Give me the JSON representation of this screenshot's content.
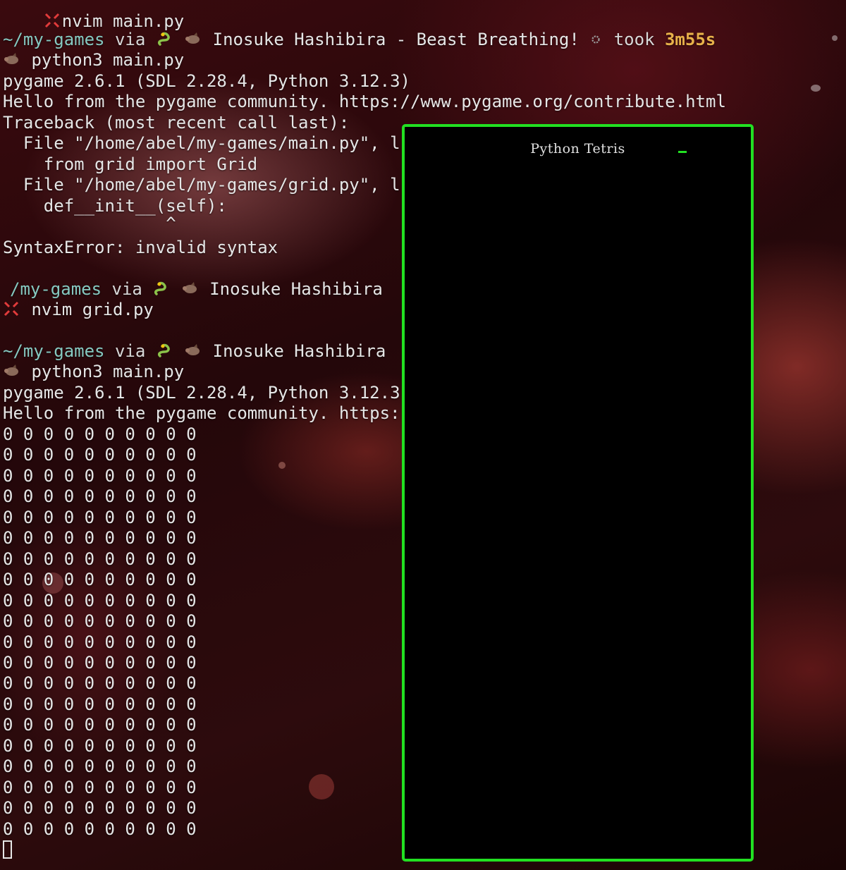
{
  "terminal": {
    "line0": "nvim main.py",
    "prompt1": {
      "path": "~/my-games",
      "via": " via ",
      "title": " Inosuke Hashibira - Beast Breathing! ",
      "took": " took ",
      "duration": "3m55s"
    },
    "cmd1": " python3 main.py",
    "out1": [
      "pygame 2.6.1 (SDL 2.28.4, Python 3.12.3)",
      "Hello from the pygame community. https://www.pygame.org/contribute.html",
      "Traceback (most recent call last):",
      "  File \"/home/abel/my-games/main.py\", l",
      "    from grid import Grid",
      "  File \"/home/abel/my-games/grid.py\", l",
      "    def__init__(self):",
      "                ^",
      "SyntaxError: invalid syntax"
    ],
    "prompt2": {
      "path": "/my-games",
      "via": " via ",
      "title": " Inosuke Hashibira"
    },
    "cmd2": " nvim grid.py",
    "prompt3": {
      "path": "~/my-games",
      "via": " via ",
      "title": " Inosuke Hashibira"
    },
    "cmd3": " python3 main.py",
    "out3": [
      "pygame 2.6.1 (SDL 2.28.4, Python 3.12.3",
      "Hello from the pygame community. https:"
    ],
    "grid_rows": [
      "0 0 0 0 0 0 0 0 0 0",
      "0 0 0 0 0 0 0 0 0 0",
      "0 0 0 0 0 0 0 0 0 0",
      "0 0 0 0 0 0 0 0 0 0",
      "0 0 0 0 0 0 0 0 0 0",
      "0 0 0 0 0 0 0 0 0 0",
      "0 0 0 0 0 0 0 0 0 0",
      "0 0 0 0 0 0 0 0 0 0",
      "0 0 0 0 0 0 0 0 0 0",
      "0 0 0 0 0 0 0 0 0 0",
      "0 0 0 0 0 0 0 0 0 0",
      "0 0 0 0 0 0 0 0 0 0",
      "0 0 0 0 0 0 0 0 0 0",
      "0 0 0 0 0 0 0 0 0 0",
      "0 0 0 0 0 0 0 0 0 0",
      "0 0 0 0 0 0 0 0 0 0",
      "0 0 0 0 0 0 0 0 0 0",
      "0 0 0 0 0 0 0 0 0 0",
      "0 0 0 0 0 0 0 0 0 0",
      "0 0 0 0 0 0 0 0 0 0"
    ]
  },
  "game_window": {
    "title": "Python Tetris",
    "border_color": "#22e022",
    "background": "#000000"
  },
  "icons": {
    "snake": "snake-icon",
    "boar": "boar-icon",
    "anger": "anger-icon",
    "gear": "gear-icon"
  },
  "colors": {
    "path": "#86c9c1",
    "duration": "#e8b24a",
    "text": "#e6e6e6"
  }
}
